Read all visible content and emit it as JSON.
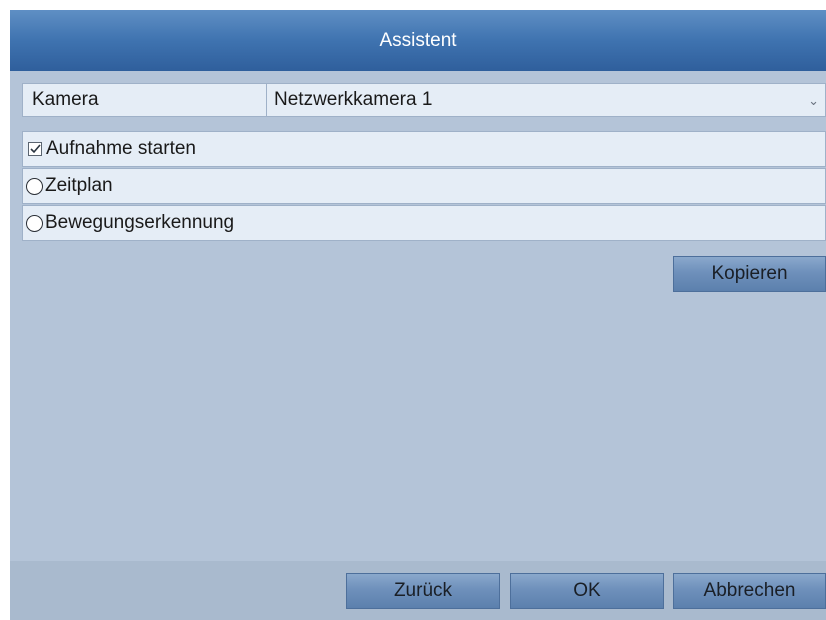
{
  "dialog": {
    "title": "Assistent"
  },
  "camera": {
    "label": "Kamera",
    "selected": "Netzwerkkamera 1",
    "arrow_icon": "chevron-down-icon"
  },
  "options": {
    "start_recording": {
      "label": "Aufnahme starten",
      "checked": true
    },
    "schedule": {
      "label": "Zeitplan",
      "selected": false
    },
    "motion": {
      "label": "Bewegungserkennung",
      "selected": false
    }
  },
  "buttons": {
    "copy": "Kopieren",
    "back": "Zurück",
    "ok": "OK",
    "cancel": "Abbrechen"
  },
  "colors": {
    "title_bar": "#3f73b0",
    "panel": "#b4c4d8",
    "row": "#e5edf6",
    "button": "#6e90bb"
  }
}
